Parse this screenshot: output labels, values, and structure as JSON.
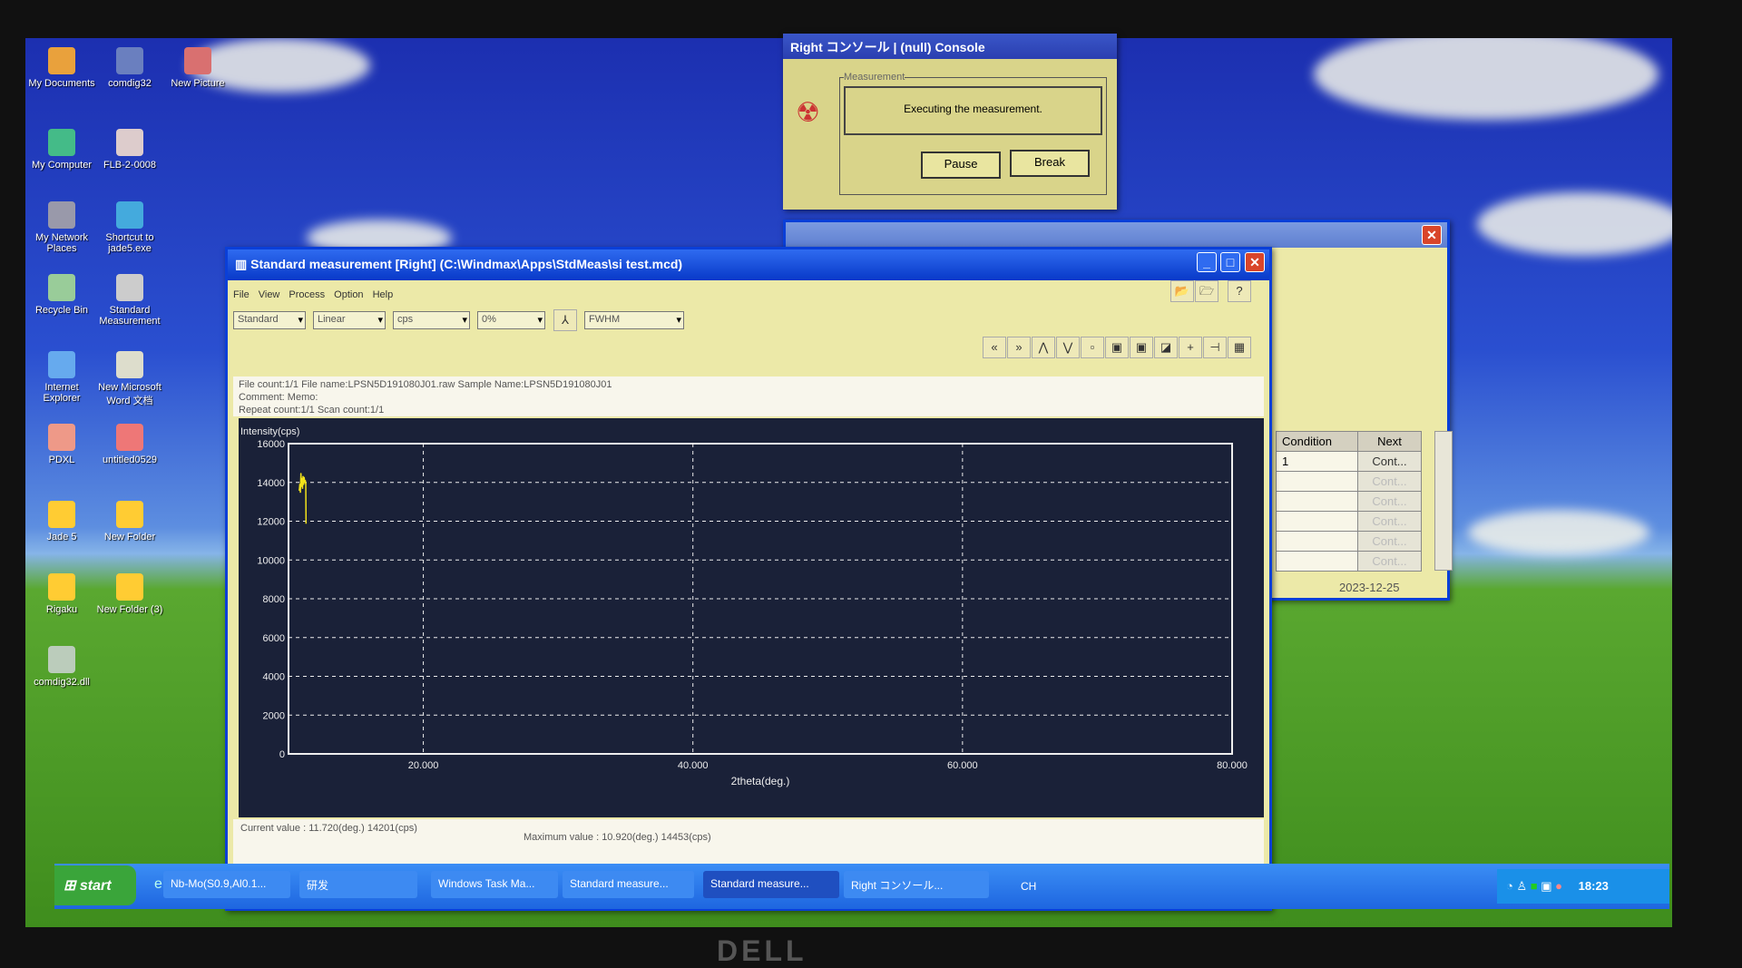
{
  "desktop_icons": [
    {
      "label": "My Documents"
    },
    {
      "label": "comdig32"
    },
    {
      "label": "New Picture"
    },
    {
      "label": "My Computer"
    },
    {
      "label": "FLB-2-0008"
    },
    {
      "label": "My Network Places"
    },
    {
      "label": "Shortcut to jade5.exe"
    },
    {
      "label": "Recycle Bin"
    },
    {
      "label": "Standard Measurement"
    },
    {
      "label": "Internet Explorer"
    },
    {
      "label": "New Microsoft Word 文档"
    },
    {
      "label": "PDXL"
    },
    {
      "label": "untitled0529"
    },
    {
      "label": "Jade 5"
    },
    {
      "label": "New Folder"
    },
    {
      "label": "Rigaku"
    },
    {
      "label": "New Folder (3)"
    },
    {
      "label": "comdig32.dll"
    }
  ],
  "console": {
    "title": "Right コンソール | (null) Console",
    "group": "Measurement",
    "message": "Executing the measurement.",
    "pause": "Pause",
    "break": "Break"
  },
  "bgwin": {
    "headers": [
      "Condition",
      "Next"
    ],
    "rows": [
      [
        "1",
        "Cont..."
      ],
      [
        "",
        "Cont..."
      ],
      [
        "",
        "Cont..."
      ],
      [
        "",
        "Cont..."
      ],
      [
        "",
        "Cont..."
      ],
      [
        "",
        "Cont..."
      ]
    ],
    "date": "2023-12-25"
  },
  "main": {
    "title": "Standard measurement [Right] (C:\\Windmax\\Apps\\StdMeas\\si  test.mcd)",
    "menu": [
      "File",
      "View",
      "Process",
      "Option",
      "Help"
    ],
    "combos": [
      "Standard",
      "Linear",
      "cps",
      "0%",
      "FWHM"
    ],
    "info": {
      "line1": "File count:1/1    File name:LPSN5D191080J01.raw    Sample Name:LPSN5D191080J01",
      "line2": "Comment:    Memo:",
      "line3": "Repeat count:1/1    Scan count:1/1"
    },
    "current": "Current value : 11.720(deg.)    14201(cps)",
    "maximum": "Maximum value : 10.920(deg.)    14453(cps)",
    "status_date": "2023-12-25",
    "status_time": "18:23"
  },
  "chart_data": {
    "type": "line",
    "xlabel": "2theta(deg.)",
    "ylabel": "Intensity(cps)",
    "xlim": [
      10,
      80
    ],
    "ylim": [
      0,
      16000
    ],
    "xticks": [
      "20.000",
      "40.000",
      "60.000",
      "80.000"
    ],
    "xtick_values": [
      20,
      40,
      60,
      80
    ],
    "yticks": [
      "0",
      "2000",
      "4000",
      "6000",
      "8000",
      "10000",
      "12000",
      "14000",
      "16000"
    ],
    "grid": true,
    "color": "#f2e21a",
    "x": [
      10.8,
      10.84,
      10.88,
      10.92,
      10.96,
      11.0,
      11.04,
      11.08,
      11.12,
      11.16,
      11.2,
      11.24,
      11.28,
      11.3
    ],
    "y": [
      13600,
      13900,
      13500,
      14453,
      13800,
      14200,
      13700,
      14300,
      13900,
      14250,
      14000,
      14100,
      13950,
      11900
    ]
  },
  "taskbar": {
    "start": "start",
    "items": [
      "Nb-Mo(S0.9,Al0.1...",
      "研发",
      "Windows Task Ma...",
      "Standard measure...",
      "Standard measure...",
      "Right コンソール..."
    ],
    "lang": "CH",
    "clock": "18:23"
  },
  "brand": "DELL"
}
